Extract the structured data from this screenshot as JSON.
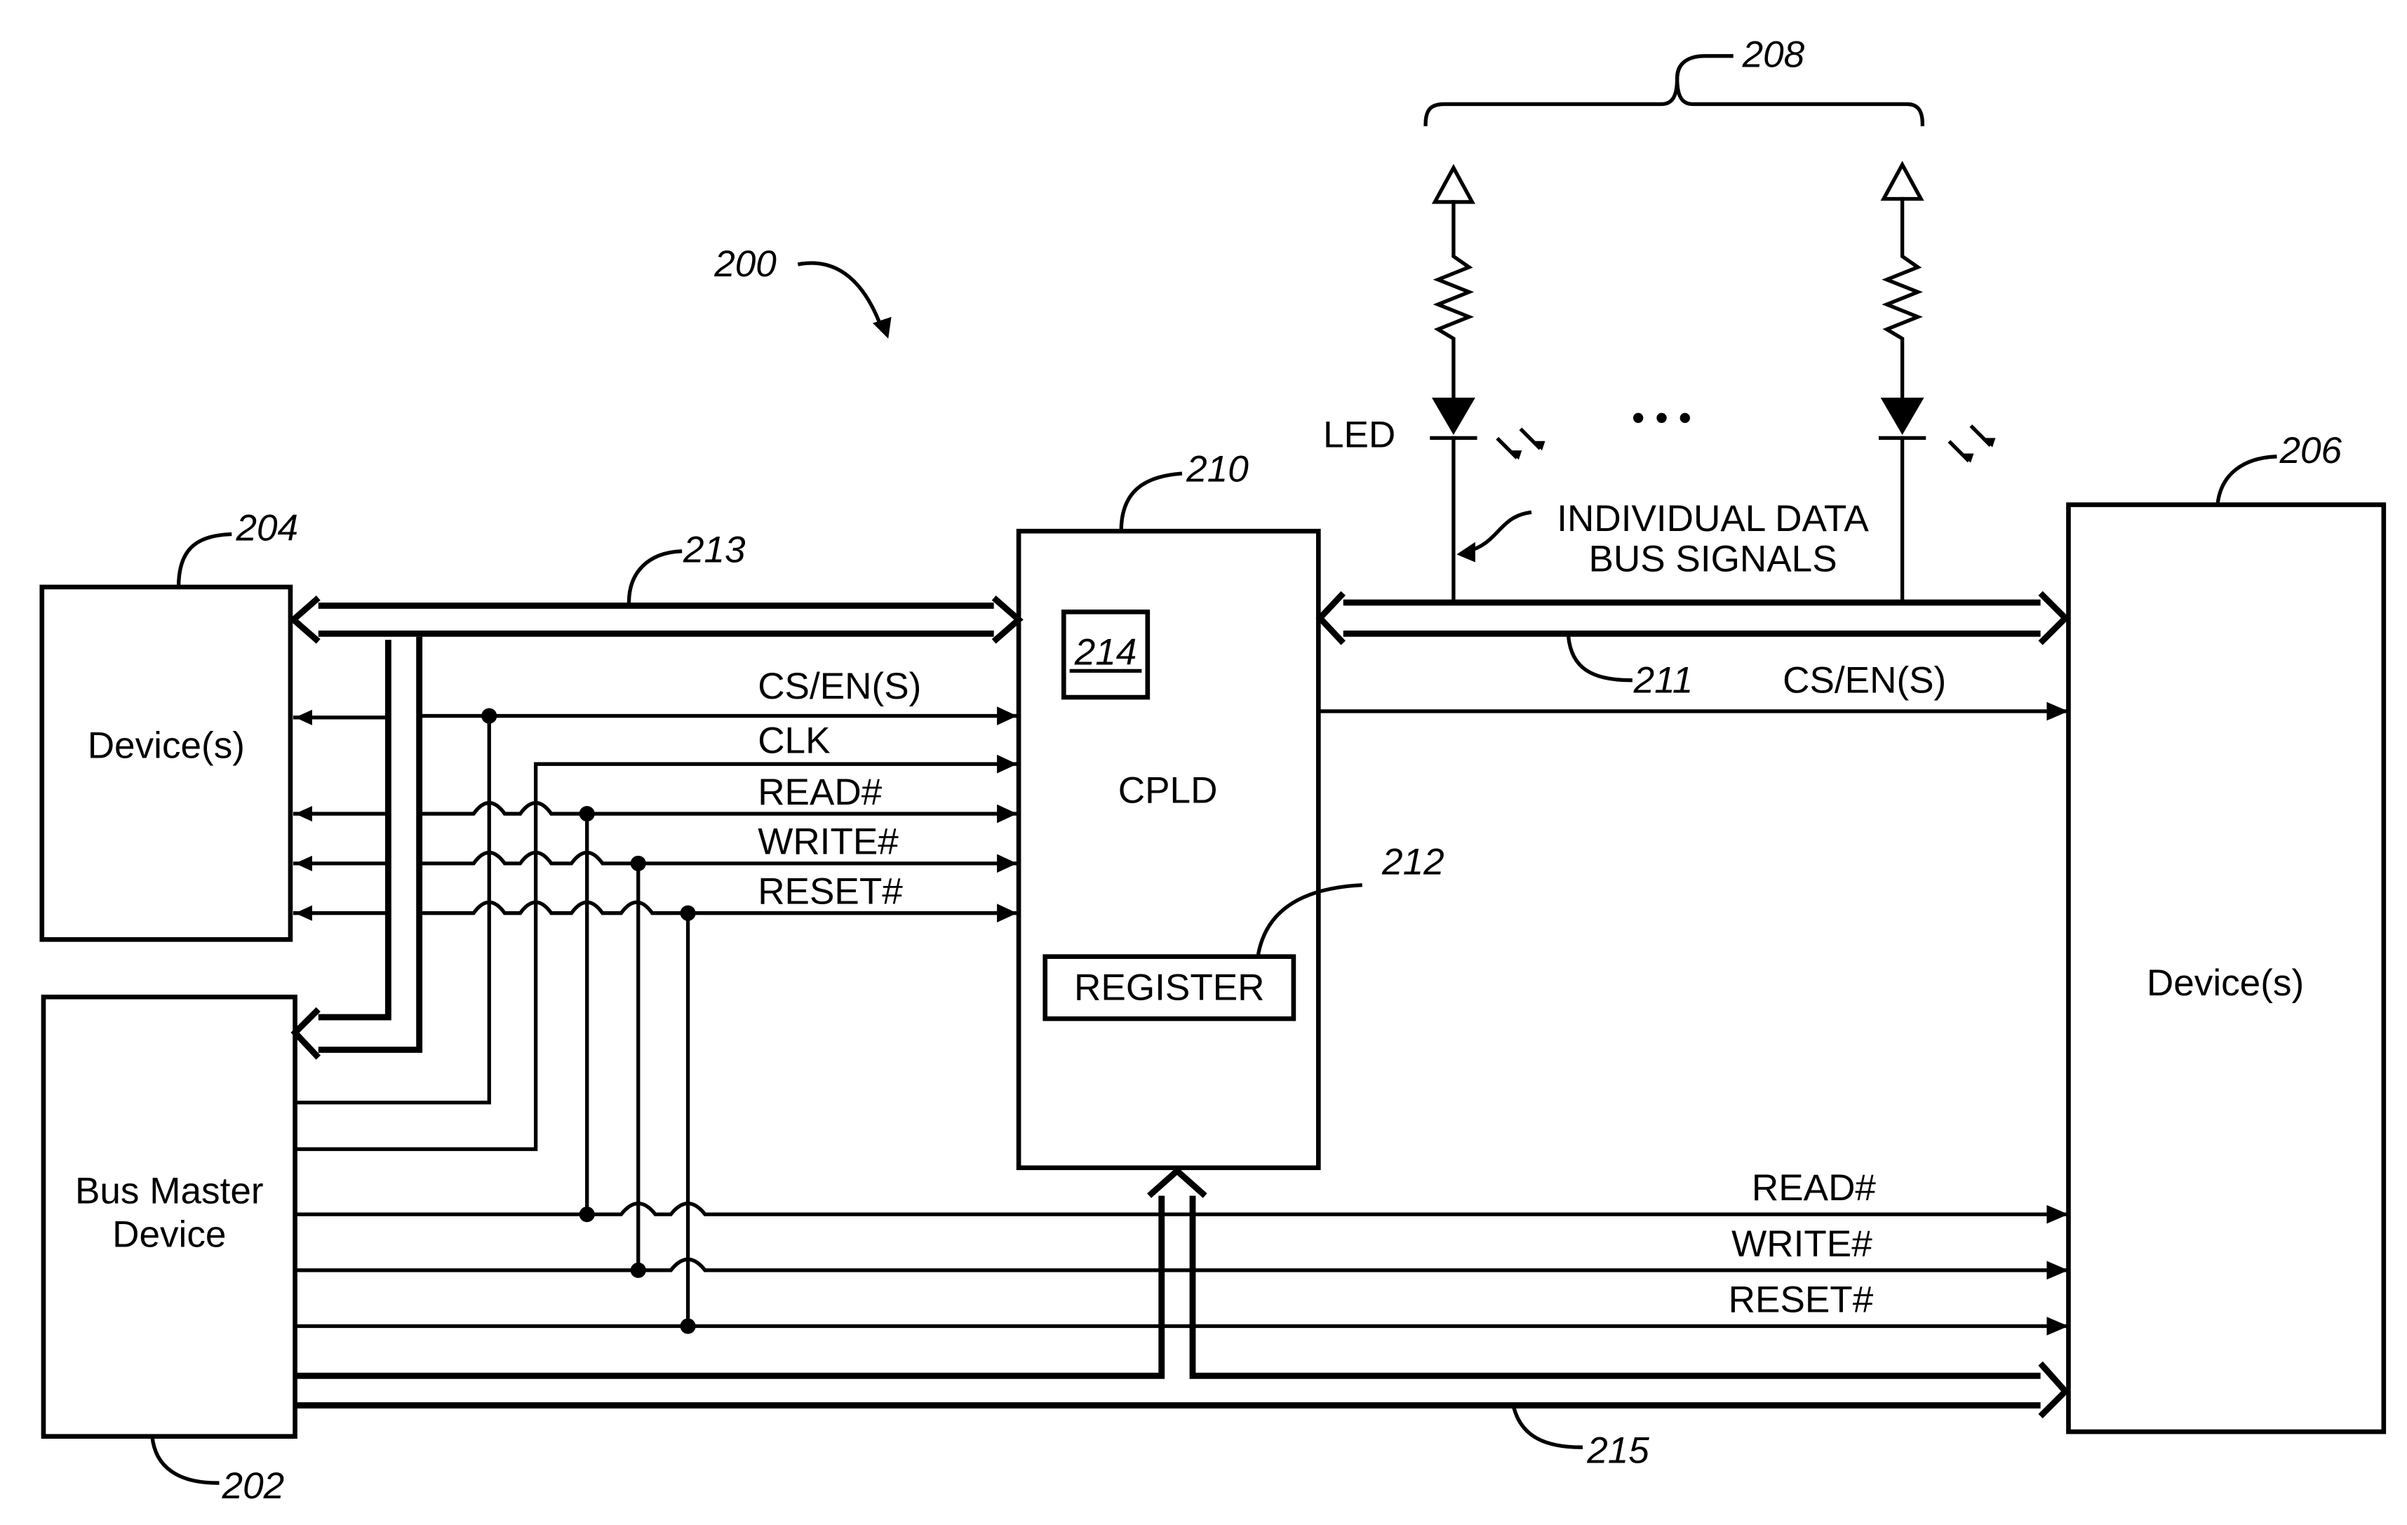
{
  "figure": {
    "ref_main": "200",
    "blocks": {
      "devices_left": {
        "label": "Device(s)",
        "ref": "204"
      },
      "bus_master": {
        "label_line1": "Bus Master",
        "label_line2": "Device",
        "ref": "202"
      },
      "cpld": {
        "label": "CPLD",
        "ref": "210",
        "inner_ref": "214"
      },
      "register": {
        "label": "REGISTER",
        "ref": "212"
      },
      "devices_right": {
        "label": "Device(s)",
        "ref": "206"
      }
    },
    "buses": {
      "left_data_bus_ref": "213",
      "right_data_bus_ref": "211",
      "bottom_data_bus_ref": "215"
    },
    "led_group": {
      "ref": "208",
      "led_label": "LED",
      "ellipsis": "• • •",
      "note_line1": "INDIVIDUAL DATA",
      "note_line2": "BUS SIGNALS"
    },
    "signals_left": [
      "CS/EN(S)",
      "CLK",
      "READ#",
      "WRITE#",
      "RESET#"
    ],
    "signals_right_top": [
      "CS/EN(S)"
    ],
    "signals_right_bottom": [
      "READ#",
      "WRITE#",
      "RESET#"
    ]
  }
}
